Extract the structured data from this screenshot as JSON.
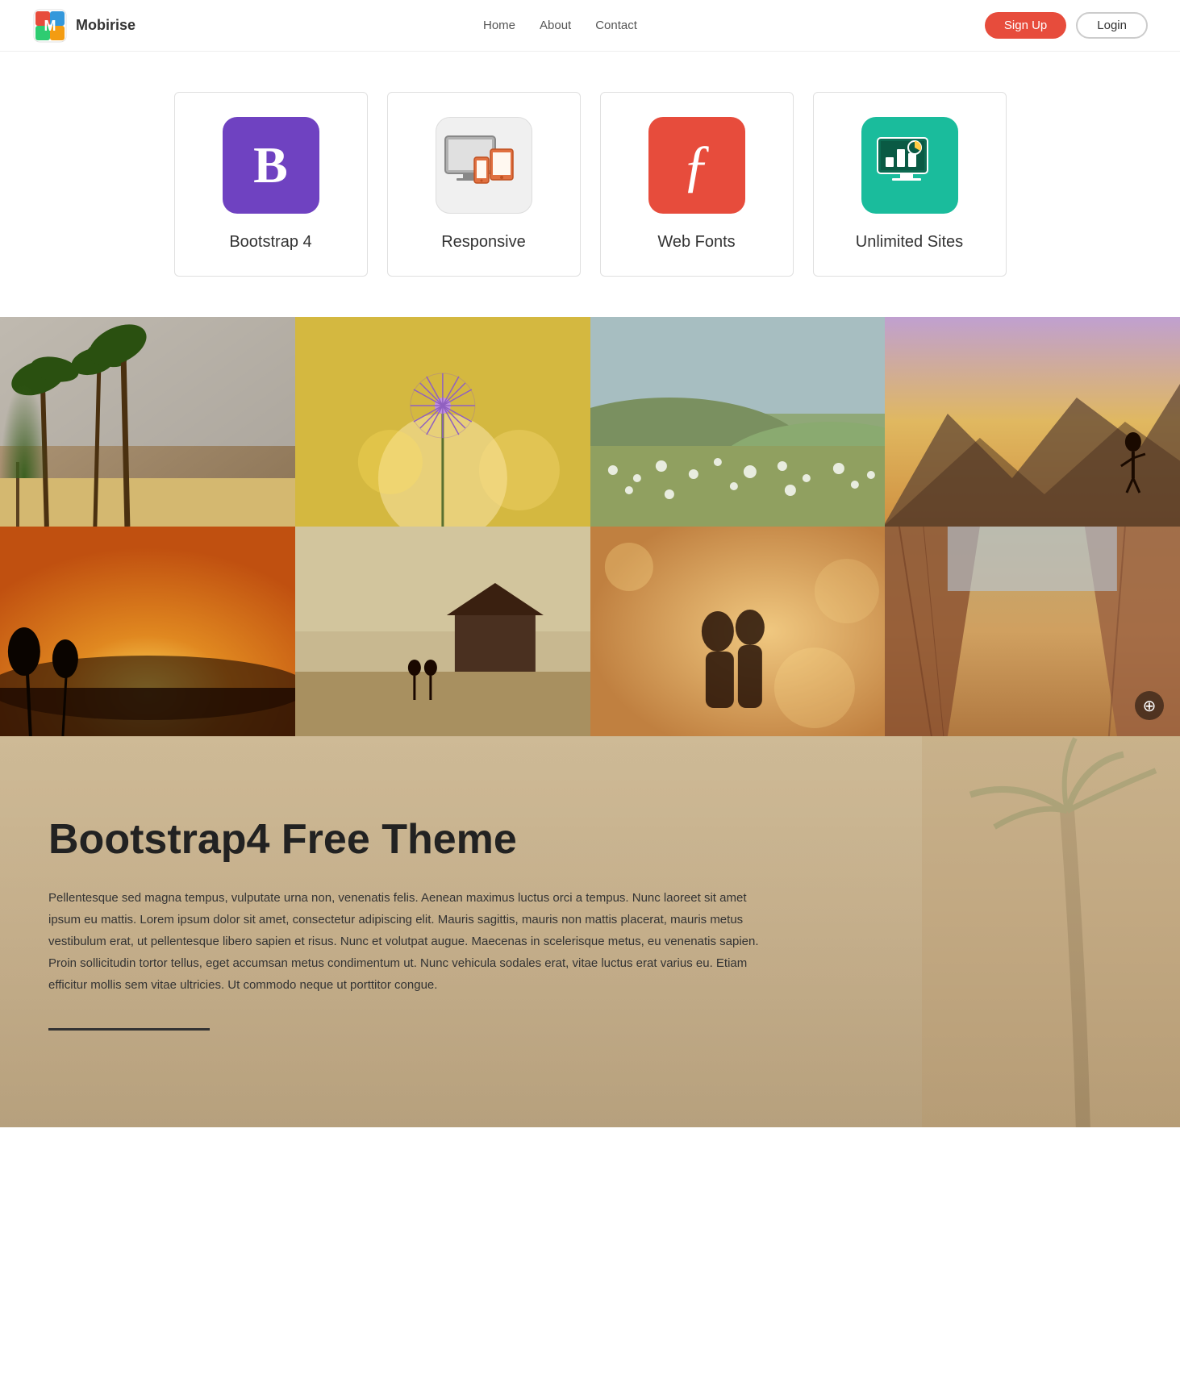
{
  "brand": {
    "name": "Mobirise",
    "logo_text": "M"
  },
  "nav": {
    "links": [
      {
        "label": "Home",
        "id": "home"
      },
      {
        "label": "About",
        "id": "about"
      },
      {
        "label": "Contact",
        "id": "contact"
      }
    ],
    "signup_label": "Sign Up",
    "login_label": "Login"
  },
  "features": [
    {
      "id": "bootstrap",
      "label": "Bootstrap 4",
      "icon_type": "bootstrap"
    },
    {
      "id": "responsive",
      "label": "Responsive",
      "icon_type": "responsive"
    },
    {
      "id": "webfonts",
      "label": "Web Fonts",
      "icon_type": "webfonts"
    },
    {
      "id": "unlimited",
      "label": "Unlimited Sites",
      "icon_type": "unlimited"
    }
  ],
  "gallery": {
    "zoom_icon": "⊕",
    "cells": [
      {
        "id": "gc1",
        "alt": "Palm trees"
      },
      {
        "id": "gc2",
        "alt": "Dandelion"
      },
      {
        "id": "gc3",
        "alt": "Flowers field"
      },
      {
        "id": "gc4",
        "alt": "Sunset landscape"
      },
      {
        "id": "gc5",
        "alt": "Golden sunset"
      },
      {
        "id": "gc6",
        "alt": "Countryside wedding"
      },
      {
        "id": "gc7",
        "alt": "Couple portrait"
      },
      {
        "id": "gc8",
        "alt": "Canyon rocks"
      }
    ]
  },
  "text_section": {
    "title": "Bootstrap4 Free Theme",
    "body": "Pellentesque sed magna tempus, vulputate urna non, venenatis felis. Aenean maximus luctus orci a tempus. Nunc laoreet sit amet ipsum eu mattis. Lorem ipsum dolor sit amet, consectetur adipiscing elit. Mauris sagittis, mauris non mattis placerat, mauris metus vestibulum erat, ut pellentesque libero sapien et risus. Nunc et volutpat augue. Maecenas in scelerisque metus, eu venenatis sapien. Proin sollicitudin tortor tellus, eget accumsan metus condimentum ut. Nunc vehicula sodales erat, vitae luctus erat varius eu. Etiam efficitur mollis sem vitae ultricies. Ut commodo neque ut porttitor congue.",
    "divider_visible": true
  }
}
